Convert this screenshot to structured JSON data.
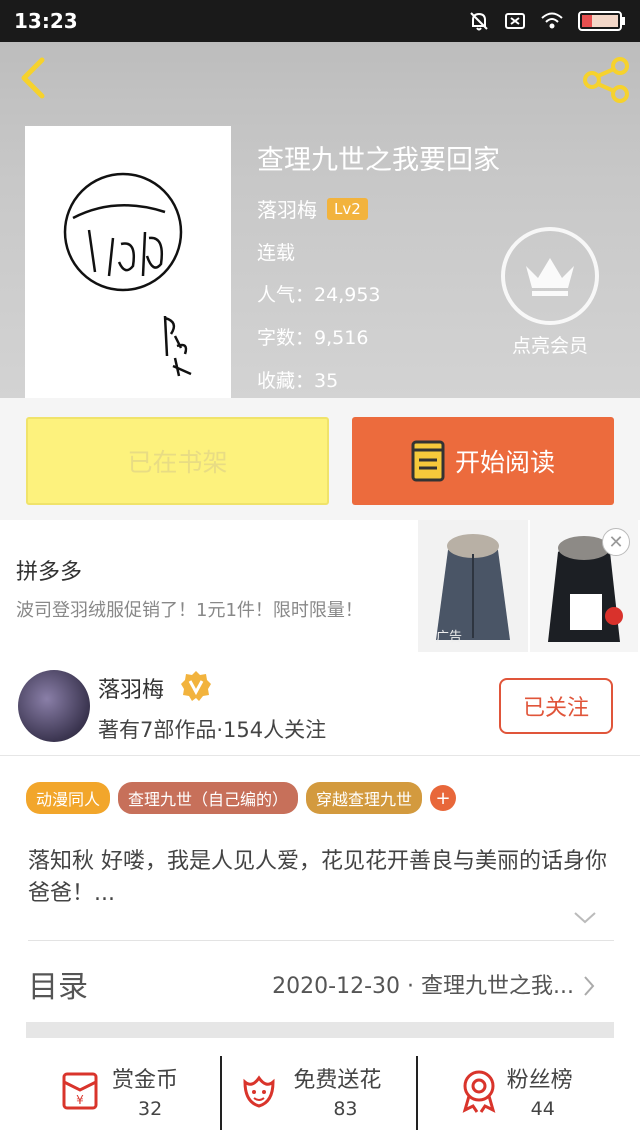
{
  "status_bar": {
    "time": "13:23"
  },
  "book": {
    "title": "查理九世之我要回家",
    "author": "落羽梅",
    "level": "Lv2",
    "status": "连载",
    "popularity_label": "人气：",
    "popularity": "24,953",
    "words_label": "字数：",
    "words": "9,516",
    "favorites_label": "收藏：",
    "favorites": "35"
  },
  "vip": {
    "label": "点亮会员"
  },
  "actions": {
    "shelf_label": "已在书架",
    "read_label": "开始阅读"
  },
  "ad": {
    "brand": "拼多多",
    "text": "波司登羽绒服促销了！1元1件！限时限量！",
    "close": "✕",
    "tag": "广告"
  },
  "author_profile": {
    "name": "落羽梅",
    "summary": "著有7部作品·154人关注",
    "follow_label": "已关注"
  },
  "tags": [
    {
      "label": "动漫同人",
      "color": "#f2a62b"
    },
    {
      "label": "查理九世（自己编的）",
      "color": "#c7705a"
    },
    {
      "label": "穿越查理九世",
      "color": "#d39a3e"
    }
  ],
  "tag_add": "+",
  "intro": "落知秋 好喽，我是人见人爱，花见花开善良与美丽的话身你爸爸！...",
  "toc": {
    "label": "目录",
    "latest": "2020-12-30 · 查理九世之我..."
  },
  "bottom_bar": [
    {
      "label": "赏金币",
      "value": "32"
    },
    {
      "label": "免费送花",
      "value": "83"
    },
    {
      "label": "粉丝榜",
      "value": "44"
    }
  ],
  "colors": {
    "accent": "#ec6b3d",
    "shelf": "#fdf27d",
    "follow": "#e0553a"
  }
}
